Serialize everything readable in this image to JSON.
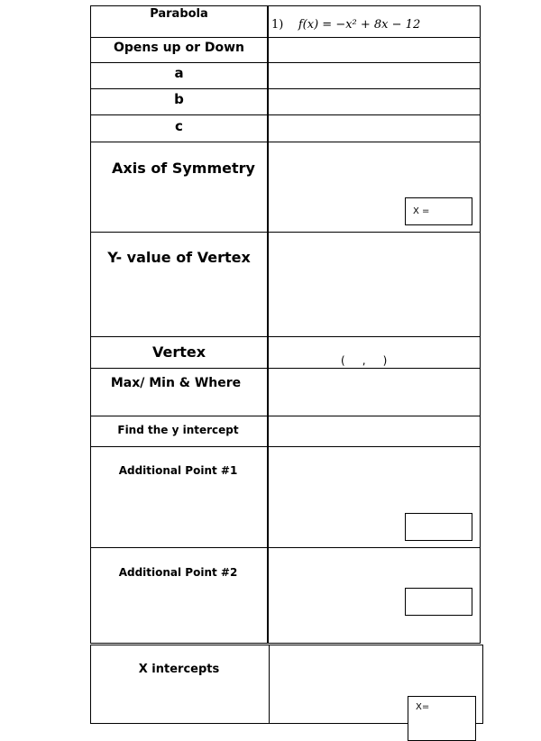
{
  "rows": [
    {
      "label": "Parabola"
    },
    {
      "label": "Opens up or Down"
    },
    {
      "label": "a"
    },
    {
      "label": "b"
    },
    {
      "label": "c"
    },
    {
      "label": "Axis of Symmetry"
    },
    {
      "label": "Y- value of Vertex"
    },
    {
      "label": "Vertex"
    },
    {
      "label": "Max/ Min & Where"
    },
    {
      "label": "Find the y intercept"
    },
    {
      "label": "Additional Point #1"
    },
    {
      "label": "Additional Point #2"
    },
    {
      "label": "X intercepts"
    }
  ],
  "problem": {
    "number": "1)",
    "equation": "f(x) = −x² + 8x − 12"
  },
  "axis_box_label": "X =",
  "vertex_template": "(     ,     )",
  "x_intercept_box_label": "X="
}
